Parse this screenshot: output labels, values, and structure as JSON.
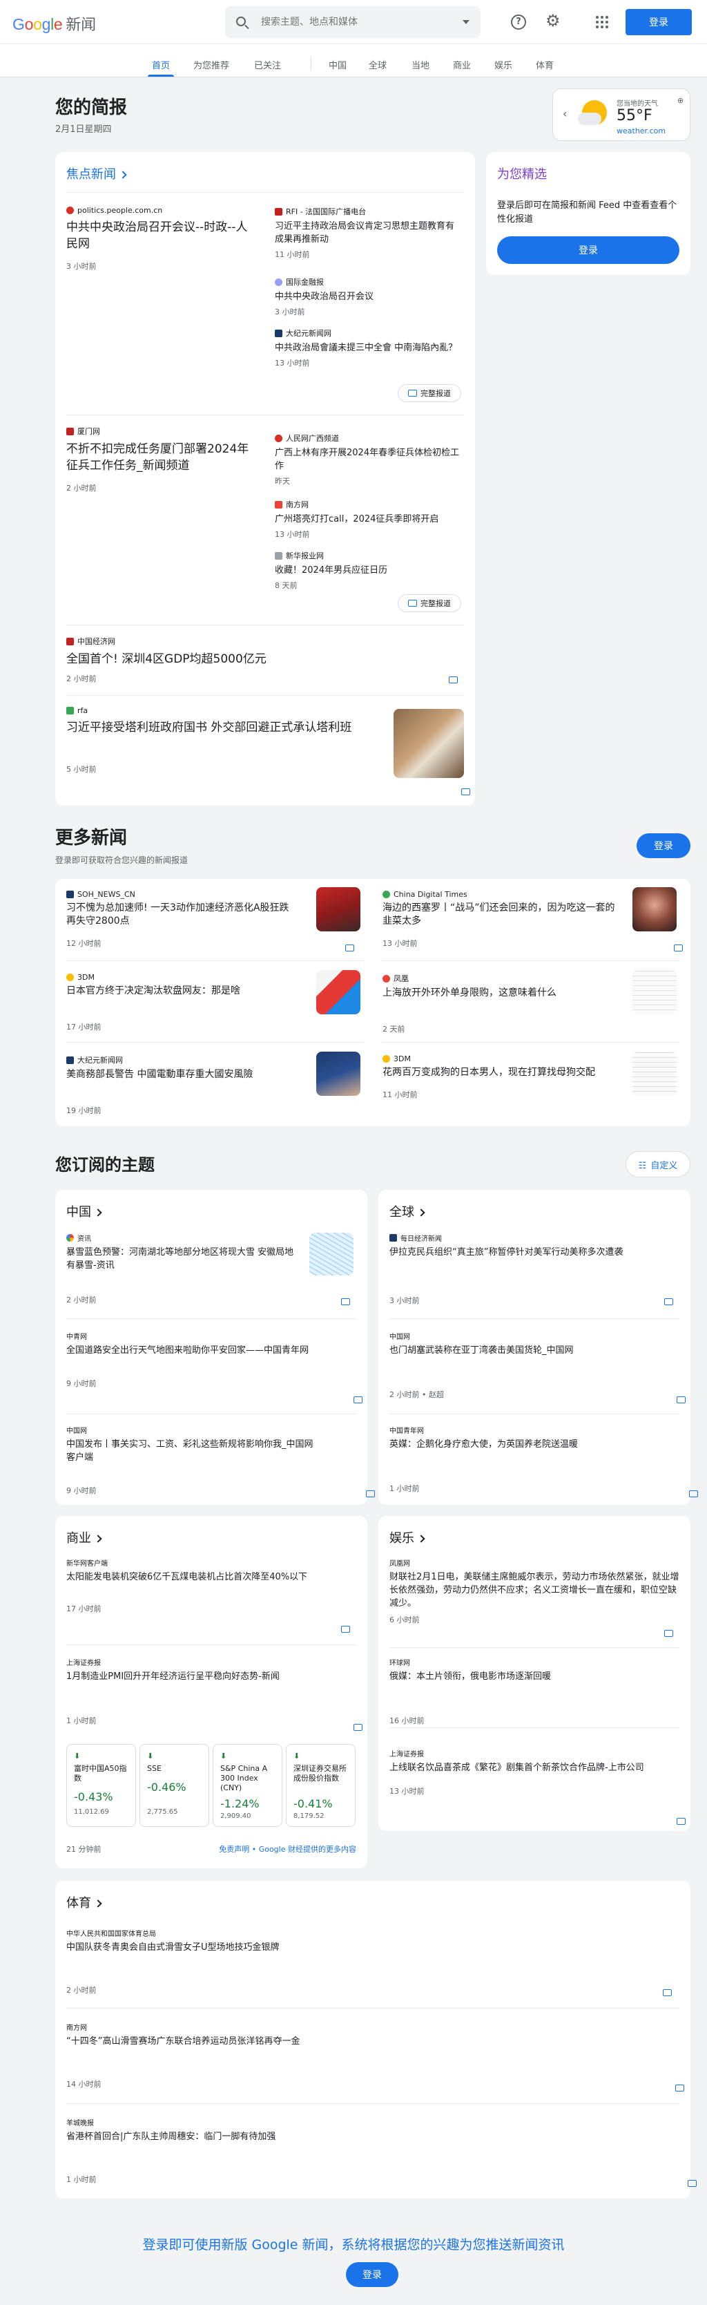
{
  "header": {
    "logo_word": "Google",
    "logo_suffix": "新闻",
    "search_placeholder": "搜索主题、地点和媒体",
    "login": "登录"
  },
  "nav": [
    "首页",
    "为您推荐",
    "已关注",
    "中国",
    "全球",
    "当地",
    "商业",
    "娱乐",
    "体育"
  ],
  "briefing": {
    "title": "您的简报",
    "date": "2月1日星期四"
  },
  "weather": {
    "label": "您当地的天气",
    "temp": "55°F",
    "source": "weather.com"
  },
  "picks": {
    "title": "为您精选",
    "text": "登录后即可在简报和新闻 Feed 中查看查看个性化报道",
    "button": "登录"
  },
  "top": {
    "title": "焦点新闻",
    "full_coverage": "完整报道",
    "clusters": [
      {
        "main": {
          "source": "politics.people.com.cn",
          "headline": "中共中央政治局召开会议--时政--人民网",
          "time": "3 小时前"
        },
        "side": [
          {
            "source": "RFI - 法国国际广播电台",
            "headline": "习近平主持政治局会议肯定习思想主题教育有成果再推新动",
            "time": "11 小时前"
          },
          {
            "source": "国际金融报",
            "headline": "中共中央政治局召开会议",
            "time": "3 小时前"
          },
          {
            "source": "大纪元新闻网",
            "headline": "中共政治局會議未提三中全會 中南海陷內亂？",
            "time": "13 小时前"
          }
        ]
      },
      {
        "main": {
          "source": "厦门网",
          "headline": "不折不扣完成任务厦门部署2024年征兵工作任务_新闻频道",
          "time": "2 小时前"
        },
        "side": [
          {
            "source": "人民网广西频道",
            "headline": "广西上林有序开展2024年春季征兵体检初检工作",
            "time": "昨天"
          },
          {
            "source": "南方网",
            "headline": "广州塔亮灯打call，2024征兵季即将开启",
            "time": "13 小时前"
          },
          {
            "source": "新华报业网",
            "headline": "收藏！2024年男兵应征日历",
            "time": "8 天前"
          }
        ]
      }
    ],
    "singles": [
      {
        "source": "中国经济网",
        "headline": "全国首个! 深圳4区GDP均超5000亿元",
        "time": "2 小时前"
      },
      {
        "source": "rfa",
        "headline": "习近平接受塔利班政府国书 外交部回避正式承认塔利班",
        "time": "5 小时前"
      }
    ]
  },
  "more": {
    "title": "更多新闻",
    "subtitle": "登录即可获取符合您兴趣的新闻报道",
    "button": "登录",
    "items": [
      {
        "source": "SOH_NEWS_CN",
        "headline": "习不愧为总加速师! 一天3动作加速经济恶化A股狂跌再失守2800点",
        "time": "12 小时前"
      },
      {
        "source": "China Digital Times",
        "headline": "海边的西塞罗丨“战马”们还会回来的，因为吃这一套的韭菜太多",
        "time": "13 小时前"
      },
      {
        "source": "3DM",
        "headline": "日本官方终于决定淘汰软盘网友：那是啥",
        "time": "17 小时前"
      },
      {
        "source": "凤凰",
        "headline": "上海放开外环外单身限购，这意味着什么",
        "time": "2 天前"
      },
      {
        "source": "大纪元新闻网",
        "headline": "美商務部長警告 中國電動車存重大國安風險",
        "time": "19 小时前"
      },
      {
        "source": "3DM",
        "headline": "花两百万变成狗的日本男人，现在打算找母狗交配",
        "time": "11 小时前"
      }
    ]
  },
  "topics": {
    "title": "您订阅的主题",
    "customize": "自定义",
    "china": {
      "title": "中国",
      "items": [
        {
          "source": "资讯",
          "headline": "暴雪蓝色预警：河南湖北等地部分地区将现大雪 安徽局地有暴雪-资讯",
          "time": "2 小时前"
        },
        {
          "source": "中青网",
          "headline": "全国道路安全出行天气地图来啦助你平安回家——中国青年网",
          "time": "9 小时前"
        },
        {
          "source": "中国网",
          "headline": "中国发布丨事关实习、工资、彩礼这些新规将影响你我_中国网客户端",
          "time": "9 小时前"
        }
      ]
    },
    "world": {
      "title": "全球",
      "items": [
        {
          "source": "每日经济新闻",
          "headline": "伊拉克民兵组织“真主旅”称暂停针对美军行动美称多次遭袭",
          "time": "3 小时前"
        },
        {
          "source": "中国网",
          "headline": "也门胡塞武装称在亚丁湾袭击美国货轮_中国网",
          "time": "2 小时前 • 赵超"
        },
        {
          "source": "中国青年网",
          "headline": "英媒：企鹅化身疗愈大使，为英国养老院送温暖",
          "time": "1 小时前"
        }
      ]
    },
    "business": {
      "title": "商业",
      "items": [
        {
          "source": "新华网客户端",
          "headline": "太阳能发电装机突破6亿千瓦煤电装机占比首次降至40%以下",
          "time": "17 小时前"
        },
        {
          "source": "上海证券报",
          "headline": "1月制造业PMI回升开年经济运行呈平稳向好态势-新闻",
          "time": "1 小时前"
        }
      ],
      "stocks": [
        {
          "name": "富时中国A50指数",
          "change": "-0.43%",
          "price": "11,012.69"
        },
        {
          "name": "SSE",
          "change": "-0.46%",
          "price": "2,775.65"
        },
        {
          "name": "S&P China A 300 Index (CNY)",
          "change": "-1.24%",
          "price": "2,909.40"
        },
        {
          "name": "深圳证券交易所成份股价指数",
          "change": "-0.41%",
          "price": "8,179.52"
        }
      ],
      "footer_time": "21 分钟前",
      "disclaimer": "免责声明 • Google 财经提供的更多内容"
    },
    "ent": {
      "title": "娱乐",
      "items": [
        {
          "source": "凤凰网",
          "headline": "财联社2月1日电，美联储主席鲍威尔表示，劳动力市场依然紧张，就业增长依然强劲，劳动力仍然供不应求；名义工资增长一直在缓和，职位空缺减少。",
          "time": "6 小时前"
        },
        {
          "source": "环球网",
          "headline": "俄媒：本土片领衔，俄电影市场逐渐回暖",
          "time": "16 小时前"
        },
        {
          "source": "上海证券报",
          "headline": "上线联名饮品喜茶成《繁花》剧集首个新茶饮合作品牌-上市公司",
          "time": "13 小时前"
        }
      ]
    },
    "sports": {
      "title": "体育",
      "items": [
        {
          "source": "中华人民共和国国家体育总局",
          "headline": "中国队获冬青奥会自由式滑雪女子U型场地技巧金银牌",
          "time": "2 小时前"
        },
        {
          "source": "南方网",
          "headline": "“十四冬”高山滑雪赛场广东联合培养运动员张洋铭再夺一金",
          "time": "14 小时前"
        },
        {
          "source": "羊城晚报",
          "headline": "省港杯首回合|广东队主帅周穗安：临门一脚有待加强",
          "time": "1 小时前"
        }
      ]
    }
  },
  "footer": {
    "text": "登录即可使用新版 Google 新闻，系统将根据您的兴趣为您推送新闻资讯",
    "button": "登录"
  },
  "colors": {
    "accent": "#1a73e8",
    "green": "#188038"
  }
}
